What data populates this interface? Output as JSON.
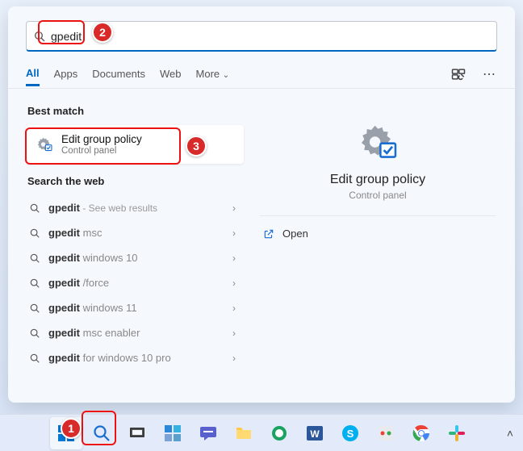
{
  "search": {
    "query": "gpedit"
  },
  "tabs": {
    "items": [
      "All",
      "Apps",
      "Documents",
      "Web",
      "More"
    ],
    "active": 0
  },
  "best_match": {
    "heading": "Best match",
    "title": "Edit group policy",
    "subtitle": "Control panel"
  },
  "web": {
    "heading": "Search the web",
    "items": [
      {
        "prefix": "gpedit",
        "suffix": "",
        "hint": " - See web results"
      },
      {
        "prefix": "gpedit ",
        "suffix": "msc",
        "hint": ""
      },
      {
        "prefix": "gpedit ",
        "suffix": "windows 10",
        "hint": ""
      },
      {
        "prefix": "gpedit ",
        "suffix": "/force",
        "hint": ""
      },
      {
        "prefix": "gpedit ",
        "suffix": "windows 11",
        "hint": ""
      },
      {
        "prefix": "gpedit ",
        "suffix": "msc enabler",
        "hint": ""
      },
      {
        "prefix": "gpedit ",
        "suffix": "for windows 10 pro",
        "hint": ""
      }
    ]
  },
  "preview": {
    "title": "Edit group policy",
    "subtitle": "Control panel",
    "open_label": "Open"
  },
  "annotations": {
    "n1": "1",
    "n2": "2",
    "n3": "3"
  }
}
